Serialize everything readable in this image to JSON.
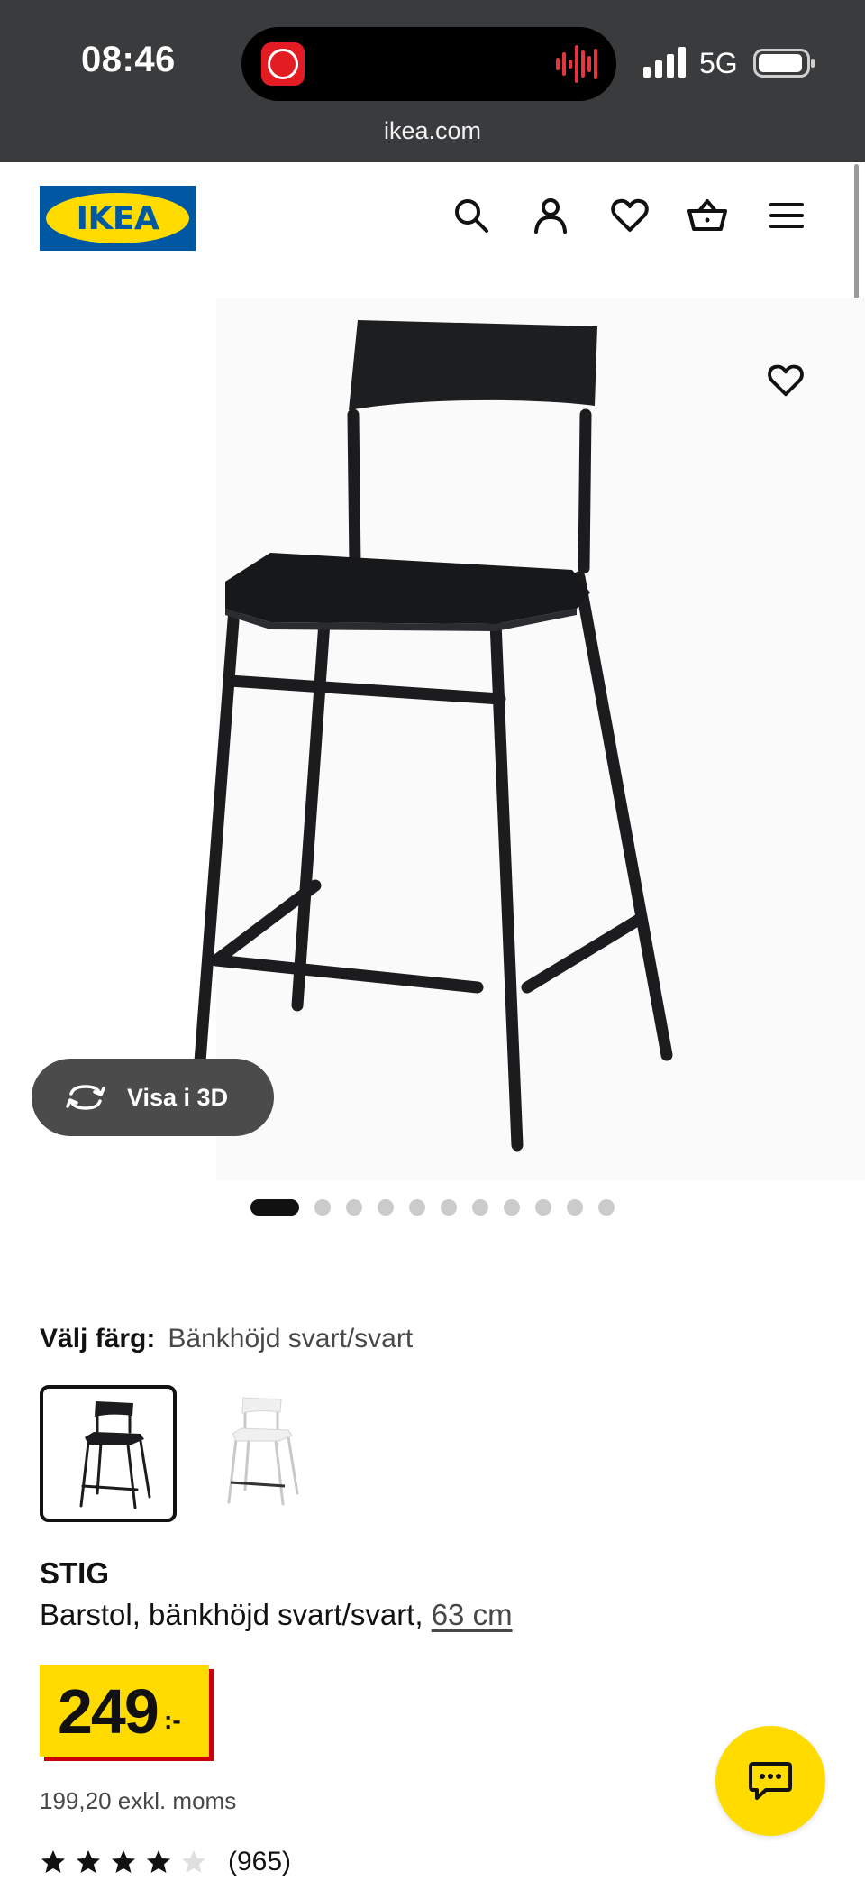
{
  "status_bar": {
    "time": "08:46",
    "network": "5G",
    "url": "ikea.com"
  },
  "header": {
    "logo_text": "IKEA",
    "icons": [
      "search-icon",
      "account-icon",
      "favourites-icon",
      "shopping-bag-icon",
      "menu-icon"
    ]
  },
  "gallery": {
    "view_3d_label": "Visa i 3D",
    "image_count": 11,
    "active_index": 0
  },
  "variant": {
    "label": "Välj färg:",
    "value": "Bänkhöjd svart/svart",
    "options": [
      {
        "color": "black",
        "selected": true
      },
      {
        "color": "white",
        "selected": false
      }
    ]
  },
  "product": {
    "name": "STIG",
    "description": "Barstol, bänkhöjd svart/svart, ",
    "measure_link": "63 cm",
    "price_main": "249",
    "price_suffix": ":-",
    "price_ex_vat": "199,20 exkl. moms",
    "rating": 4,
    "rating_max": 5,
    "review_count": "(965)"
  },
  "colors": {
    "ikea_blue": "#0058a3",
    "ikea_yellow": "#ffdb00",
    "price_shadow": "#cc0008",
    "topbar": "#3a3b3d"
  }
}
